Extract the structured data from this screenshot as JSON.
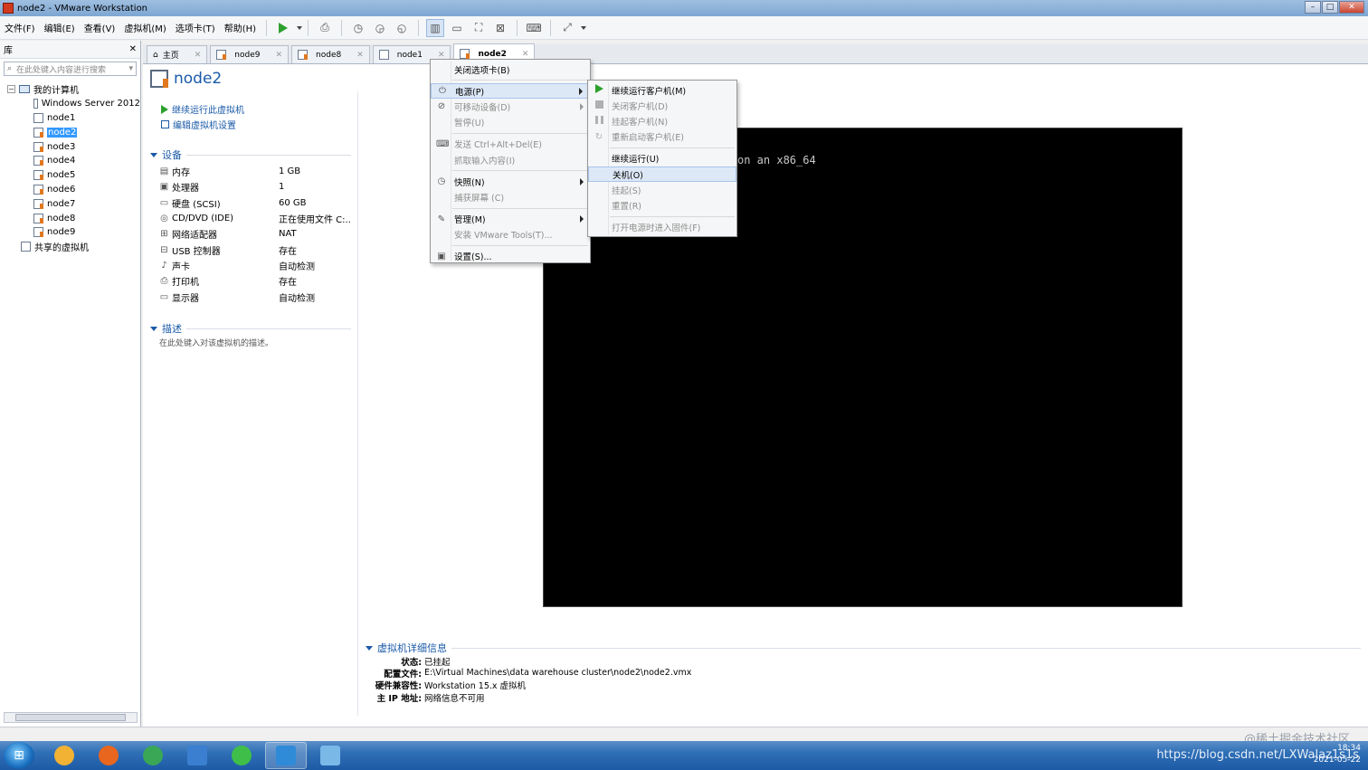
{
  "window": {
    "title": "node2 - VMware Workstation"
  },
  "menubar": [
    "文件(F)",
    "编辑(E)",
    "查看(V)",
    "虚拟机(M)",
    "选项卡(T)",
    "帮助(H)"
  ],
  "library": {
    "title": "库",
    "close": "✕",
    "search_placeholder": "在此处键入内容进行搜索",
    "root": "我的计算机",
    "items": [
      "Windows Server 2012",
      "node1",
      "node2",
      "node3",
      "node4",
      "node5",
      "node6",
      "node7",
      "node8",
      "node9"
    ],
    "selected": "node2",
    "shared": "共享的虚拟机"
  },
  "tabs": [
    {
      "label": "主页",
      "close": "✕"
    },
    {
      "label": "node9",
      "close": "✕"
    },
    {
      "label": "node8",
      "close": "✕"
    },
    {
      "label": "node1",
      "close": "✕"
    },
    {
      "label": "node2",
      "close": "✕"
    }
  ],
  "vm": {
    "name": "node2",
    "actions": [
      "继续运行此虚拟机",
      "编辑虚拟机设置"
    ],
    "devices_title": "设备",
    "devices": [
      {
        "icon": "memory-icon",
        "name": "内存",
        "value": "1 GB"
      },
      {
        "icon": "cpu-icon",
        "name": "处理器",
        "value": "1"
      },
      {
        "icon": "disk-icon",
        "name": "硬盘 (SCSI)",
        "value": "60 GB"
      },
      {
        "icon": "cd-icon",
        "name": "CD/DVD (IDE)",
        "value": "正在使用文件 C:..."
      },
      {
        "icon": "network-icon",
        "name": "网络适配器",
        "value": "NAT"
      },
      {
        "icon": "usb-icon",
        "name": "USB 控制器",
        "value": "存在"
      },
      {
        "icon": "sound-icon",
        "name": "声卡",
        "value": "自动检测"
      },
      {
        "icon": "printer-icon",
        "name": "打印机",
        "value": "存在"
      },
      {
        "icon": "display-icon",
        "name": "显示器",
        "value": "自动检测"
      }
    ],
    "description_title": "描述",
    "description_placeholder": "在此处键入对该虚拟机的描述。",
    "console_text": "on an x86_64",
    "details_title": "虚拟机详细信息",
    "details": [
      {
        "k": "状态:",
        "v": "已挂起"
      },
      {
        "k": "配置文件:",
        "v": "E:\\Virtual Machines\\data warehouse cluster\\node2\\node2.vmx"
      },
      {
        "k": "硬件兼容性:",
        "v": "Workstation 15.x 虚拟机"
      },
      {
        "k": "主 IP 地址:",
        "v": "网络信息不可用"
      }
    ]
  },
  "context_menu": {
    "items": [
      {
        "label": "关闭选项卡(B)",
        "disabled": false,
        "submenu": false,
        "icon": ""
      },
      {
        "sep": true
      },
      {
        "label": "电源(P)",
        "disabled": false,
        "submenu": true,
        "icon": "power-icon",
        "highlight": true
      },
      {
        "label": "可移动设备(D)",
        "disabled": true,
        "submenu": true,
        "icon": "removable-device-icon"
      },
      {
        "label": "暂停(U)",
        "disabled": true,
        "submenu": false,
        "icon": ""
      },
      {
        "sep": true
      },
      {
        "label": "发送 Ctrl+Alt+Del(E)",
        "disabled": true,
        "submenu": false,
        "icon": "keyboard-icon"
      },
      {
        "label": "抓取输入内容(I)",
        "disabled": true,
        "submenu": false,
        "icon": ""
      },
      {
        "sep": true
      },
      {
        "label": "快照(N)",
        "disabled": false,
        "submenu": true,
        "icon": "snapshot-icon"
      },
      {
        "label": "捕获屏幕 (C)",
        "disabled": true,
        "submenu": false,
        "icon": ""
      },
      {
        "sep": true
      },
      {
        "label": "管理(M)",
        "disabled": false,
        "submenu": true,
        "icon": "wrench-icon"
      },
      {
        "label": "安装 VMware Tools(T)...",
        "disabled": true,
        "submenu": false,
        "icon": ""
      },
      {
        "sep": true
      },
      {
        "label": "设置(S)...",
        "disabled": false,
        "submenu": false,
        "icon": "settings-icon"
      }
    ]
  },
  "power_submenu": {
    "items": [
      {
        "label": "继续运行客户机(M)",
        "disabled": false,
        "icon": "play-icon"
      },
      {
        "label": "关闭客户机(D)",
        "disabled": true,
        "icon": "stop-icon"
      },
      {
        "label": "挂起客户机(N)",
        "disabled": true,
        "icon": "pause-icon"
      },
      {
        "label": "重新启动客户机(E)",
        "disabled": true,
        "icon": "restart-icon"
      },
      {
        "sep": true
      },
      {
        "label": "继续运行(U)",
        "disabled": false,
        "icon": ""
      },
      {
        "label": "关机(O)",
        "disabled": false,
        "icon": "",
        "highlight": true
      },
      {
        "label": "挂起(S)",
        "disabled": true,
        "icon": ""
      },
      {
        "label": "重置(R)",
        "disabled": true,
        "icon": ""
      },
      {
        "sep": true
      },
      {
        "label": "打开电源时进入固件(F)",
        "disabled": true,
        "icon": ""
      }
    ]
  },
  "statusbar": {
    "watermark": "@稀土掘金技术社区"
  },
  "taskbar": {
    "apps": [
      {
        "name": "explorer-icon",
        "color": "#f2b233"
      },
      {
        "name": "firefox-icon",
        "color": "#e8661e"
      },
      {
        "name": "chrome-icon",
        "color": "#3aa757"
      },
      {
        "name": "teamviewer-icon",
        "color": "#3a7fd0"
      },
      {
        "name": "wechat-icon",
        "color": "#3fbf4a"
      },
      {
        "name": "vmware-icon",
        "color": "#2f8bd8"
      },
      {
        "name": "media-icon",
        "color": "#7ab8e8"
      }
    ],
    "url": "https://blog.csdn.net/LXWalaz1s1s",
    "time": "18:34",
    "date": "2021-05-22"
  }
}
